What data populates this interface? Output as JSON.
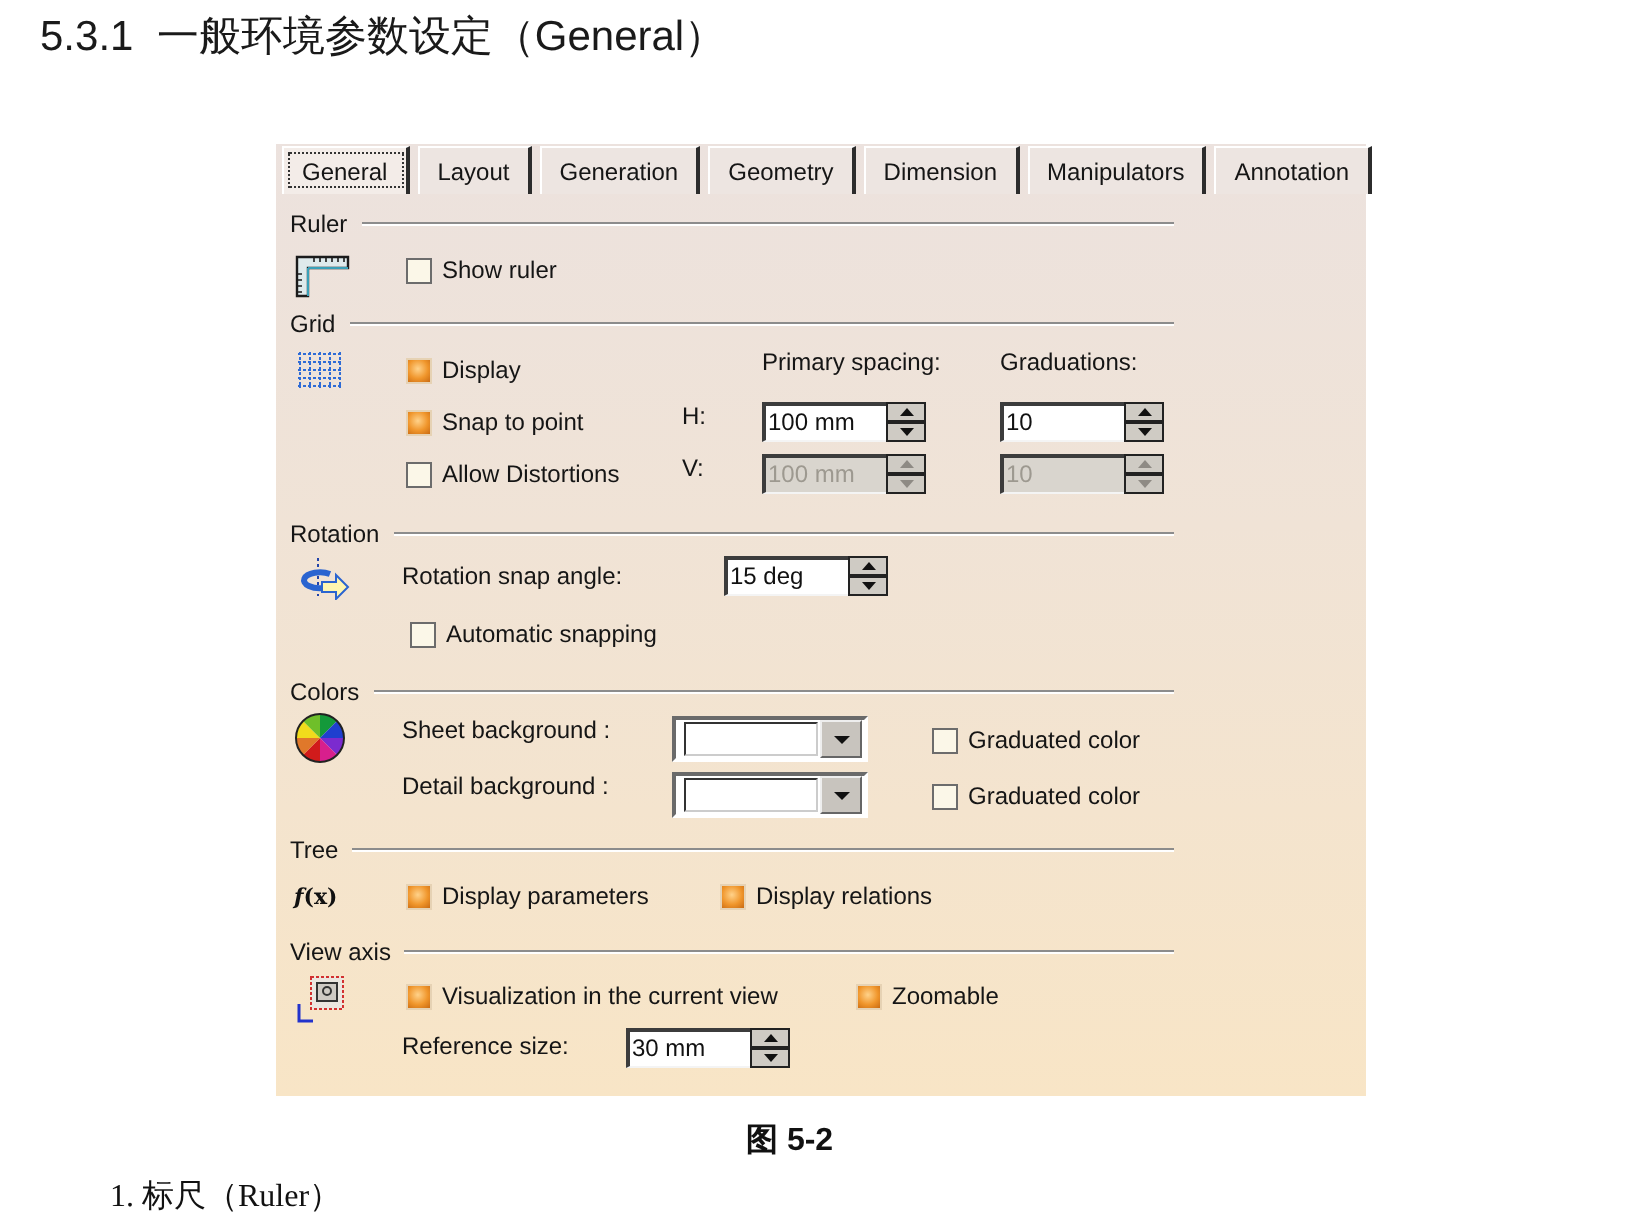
{
  "heading": "5.3.1  一般环境参数设定（General）",
  "dialog": {
    "tabs": [
      {
        "label": "General",
        "selected": true
      },
      {
        "label": "Layout",
        "selected": false
      },
      {
        "label": "Generation",
        "selected": false
      },
      {
        "label": "Geometry",
        "selected": false
      },
      {
        "label": "Dimension",
        "selected": false
      },
      {
        "label": "Manipulators",
        "selected": false
      },
      {
        "label": "Annotation",
        "selected": false
      }
    ],
    "sections": [
      {
        "kind": "ruler",
        "title": "Ruler",
        "show_ruler": {
          "label": "Show ruler",
          "checked": false
        }
      },
      {
        "kind": "grid",
        "title": "Grid",
        "options": [
          {
            "label": "Display",
            "checked": true
          },
          {
            "label": "Snap to point",
            "checked": true
          },
          {
            "label": "Allow Distortions",
            "checked": false
          }
        ],
        "columns": [
          "Primary spacing:",
          "Graduations:"
        ],
        "rows": [
          {
            "label": "H:",
            "primary_spacing": {
              "value": "100 mm",
              "disabled": false
            },
            "graduations": {
              "value": "10",
              "disabled": false
            }
          },
          {
            "label": "V:",
            "primary_spacing": {
              "value": "100 mm",
              "disabled": true
            },
            "graduations": {
              "value": "10",
              "disabled": true
            }
          }
        ]
      },
      {
        "kind": "rotation",
        "title": "Rotation",
        "snap_angle": {
          "label": "Rotation snap angle:",
          "value": "15 deg"
        },
        "automatic_snapping": {
          "label": "Automatic snapping",
          "checked": false
        }
      },
      {
        "kind": "colors",
        "title": "Colors",
        "backgrounds": [
          {
            "label": "Sheet background :",
            "graduated_color": {
              "label": "Graduated color",
              "checked": false
            }
          },
          {
            "label": "Detail background :",
            "graduated_color": {
              "label": "Graduated color",
              "checked": false
            }
          }
        ]
      },
      {
        "kind": "tree",
        "title": "Tree",
        "icon_text": "*f*(x)",
        "options": [
          {
            "label": "Display parameters",
            "checked": true
          },
          {
            "label": "Display relations",
            "checked": true
          }
        ]
      },
      {
        "kind": "view_axis",
        "title": "View axis",
        "options": [
          {
            "label": "Visualization in the current view",
            "checked": true
          },
          {
            "label": "Zoomable",
            "checked": true
          }
        ],
        "reference_size": {
          "label": "Reference size:",
          "value": "30 mm"
        }
      }
    ]
  },
  "caption": "图 5-2",
  "list_item": "1. 标尺（Ruler）"
}
